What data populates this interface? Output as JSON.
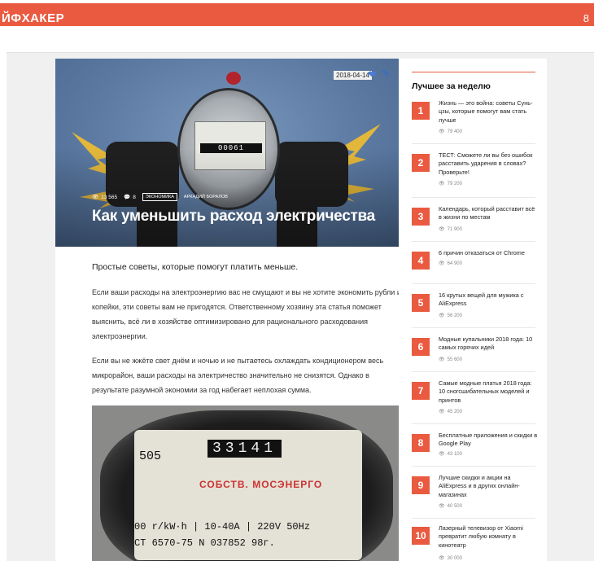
{
  "header": {
    "logo": "ЙФХАКЕР",
    "user_icon": "8",
    "accent_color": "#ea5a40"
  },
  "article": {
    "date": "2018-04-14",
    "views": "13 565",
    "comments": "8",
    "category": "ЭКОНОМИКА",
    "author": "АРКАДИЙ БОРАЛОВ",
    "title": "Как уменьшить расход электричества",
    "hero_meter_digits": "00061",
    "lead": "Простые советы, которые помогут платить меньше.",
    "paragraph1": "Если ваши расходы на электроэнергию вас не смущают и вы не хотите экономить рубли и копейки, эти советы вам не пригодятся. Ответственному хозяину эта статья поможет выяснить, всё ли в хозяйстве оптимизировано для рационального расходования электроэнергии.",
    "paragraph2": "Если вы не жжёте свет днём и ночью и не пытаетесь охлаждать кондиционером весь микрорайон, ваши расходы на электричество значительно не снизятся. Однако в результате разумной экономии за год набегает неплохая сумма.",
    "photo": {
      "digits": "33141",
      "left_number": "505",
      "brand": "СОБСТВ. МОСЭНЕРГО",
      "spec": "00 r/kW·h | 10-40A | 220V 50Hz",
      "serial": "CT 6570-75 N  037852 98г."
    }
  },
  "sidebar": {
    "title": "Лучшее за неделю",
    "items": [
      {
        "num": "1",
        "text": "Жизнь — это война: советы Сунь-цзы, которые помогут вам стать лучше",
        "views": "79 400"
      },
      {
        "num": "2",
        "text": "ТЕСТ: Сможете ли вы без ошибок расставить ударения в словах? Проверьте!",
        "views": "79 200"
      },
      {
        "num": "3",
        "text": "Календарь, который расставит всё в жизни по местам",
        "views": "71 900"
      },
      {
        "num": "4",
        "text": "6 причин отказаться от Chrome",
        "views": "64 900"
      },
      {
        "num": "5",
        "text": "16 крутых вещей для мужика с AliExpress",
        "views": "56 200"
      },
      {
        "num": "6",
        "text": "Модные купальники 2018 года: 10 самых горячих идей",
        "views": "55 600"
      },
      {
        "num": "7",
        "text": "Самые модные платья 2018 года: 10 сногсшибательных моделей и принтов",
        "views": "45 200"
      },
      {
        "num": "8",
        "text": "Бесплатные приложения и скидки в Google Play",
        "views": "43 100"
      },
      {
        "num": "9",
        "text": "Лучшие скидки и акции на AliExpress и в других онлайн-магазинах",
        "views": "40 500"
      },
      {
        "num": "10",
        "text": "Лазерный телевизор от Xiaomi превратит любую комнату в кинотеатр",
        "views": "30 000"
      }
    ]
  }
}
